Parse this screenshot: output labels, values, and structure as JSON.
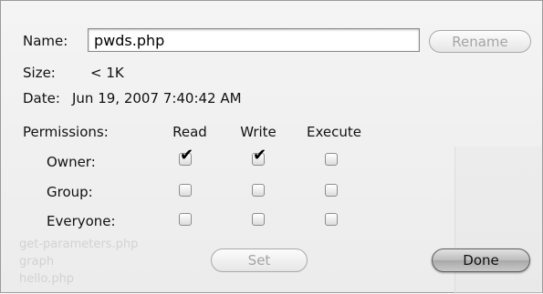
{
  "dialog": {
    "name_label": "Name:",
    "name_value": "pwds.php",
    "rename_button": "Rename",
    "size_label": "Size:",
    "size_value": "< 1K",
    "date_label": "Date:",
    "date_value": "Jun 19, 2007 7:40:42 AM",
    "permissions_label": "Permissions:",
    "columns": [
      "Read",
      "Write",
      "Execute"
    ],
    "rows": [
      {
        "label": "Owner:",
        "checked": [
          true,
          true,
          false
        ]
      },
      {
        "label": "Group:",
        "checked": [
          false,
          false,
          false
        ]
      },
      {
        "label": "Everyone:",
        "checked": [
          false,
          false,
          false
        ]
      }
    ],
    "set_button": "Set",
    "done_button": "Done"
  },
  "background": {
    "files": [
      "get-parameters.php",
      "graph",
      "hello.php"
    ]
  }
}
